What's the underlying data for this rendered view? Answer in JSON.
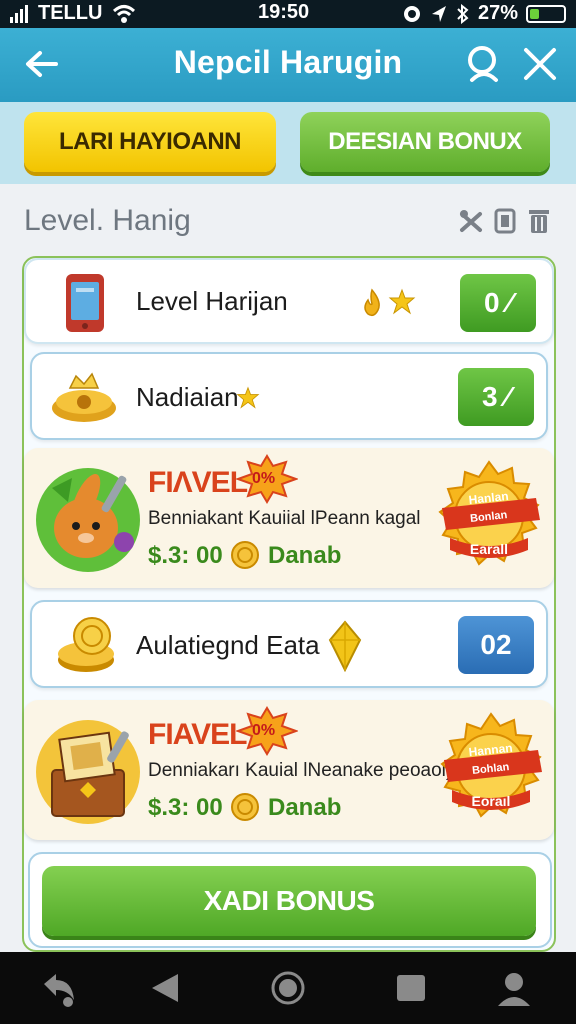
{
  "status_bar": {
    "carrier": "TELLU",
    "time": "19:50",
    "battery": "27%",
    "battery_level": 0.27,
    "icons": [
      "wifi-icon",
      "alarm-icon",
      "location-icon",
      "bluetooth-icon",
      "battery-icon"
    ]
  },
  "app_bar": {
    "title": "Nepcil Harugin",
    "icons": [
      "back-arrow-icon",
      "search-icon",
      "close-icon"
    ]
  },
  "tabs": [
    {
      "label": "LARI HAYIOANN",
      "color": "#f5cc10"
    },
    {
      "label": "DEESIAN BONUX",
      "color": "#6db83a"
    }
  ],
  "section": {
    "title": "Level. Hanig",
    "icons": [
      "tools-icon",
      "copy-icon",
      "trash-icon"
    ]
  },
  "items": [
    {
      "label": "Level Harijan",
      "value": "0 ⁄",
      "badge_color": "#4ea82a",
      "icons": [
        "phone-icon",
        "flame-icon",
        "star-icon"
      ]
    },
    {
      "label": "Nadiaian",
      "value": "3 ⁄",
      "badge_color": "#4ea82a",
      "icons": [
        "treasure-crown-icon",
        "star-icon"
      ]
    },
    {
      "title": "FIΛVEL",
      "discount": "0%",
      "description": "Benniakant Kauiial lPeann kagal",
      "price": "$.3: 00",
      "price_label": "Danab",
      "seal_top": "Hanlan",
      "seal_mid": "Bonlan",
      "seal_bottom": "Earall",
      "icons": [
        "bear-mascot-icon",
        "coin-icon",
        "seal-badge-icon"
      ]
    },
    {
      "label": "Aulatiegnd Eata",
      "value": "02",
      "badge_color": "#2f76bc",
      "icons": [
        "gold-coins-icon",
        "gem-icon"
      ]
    },
    {
      "title": "FIAVEL",
      "discount": "0%",
      "description": "Denniakarı Kauial lNeanake peoaol)",
      "price": "$.3: 00",
      "price_label": "Danab",
      "seal_top": "Hannan",
      "seal_mid": "Bohlan",
      "seal_bottom": "Eoraıl",
      "icons": [
        "treasure-chest-icon",
        "coin-icon",
        "seal-badge-icon"
      ]
    }
  ],
  "bonus_button": {
    "label": "XADI BONUS"
  },
  "nav_bar": {
    "icons": [
      "shortcut-icon",
      "back-triangle-icon",
      "home-circle-icon",
      "recents-square-icon",
      "profile-icon"
    ]
  }
}
